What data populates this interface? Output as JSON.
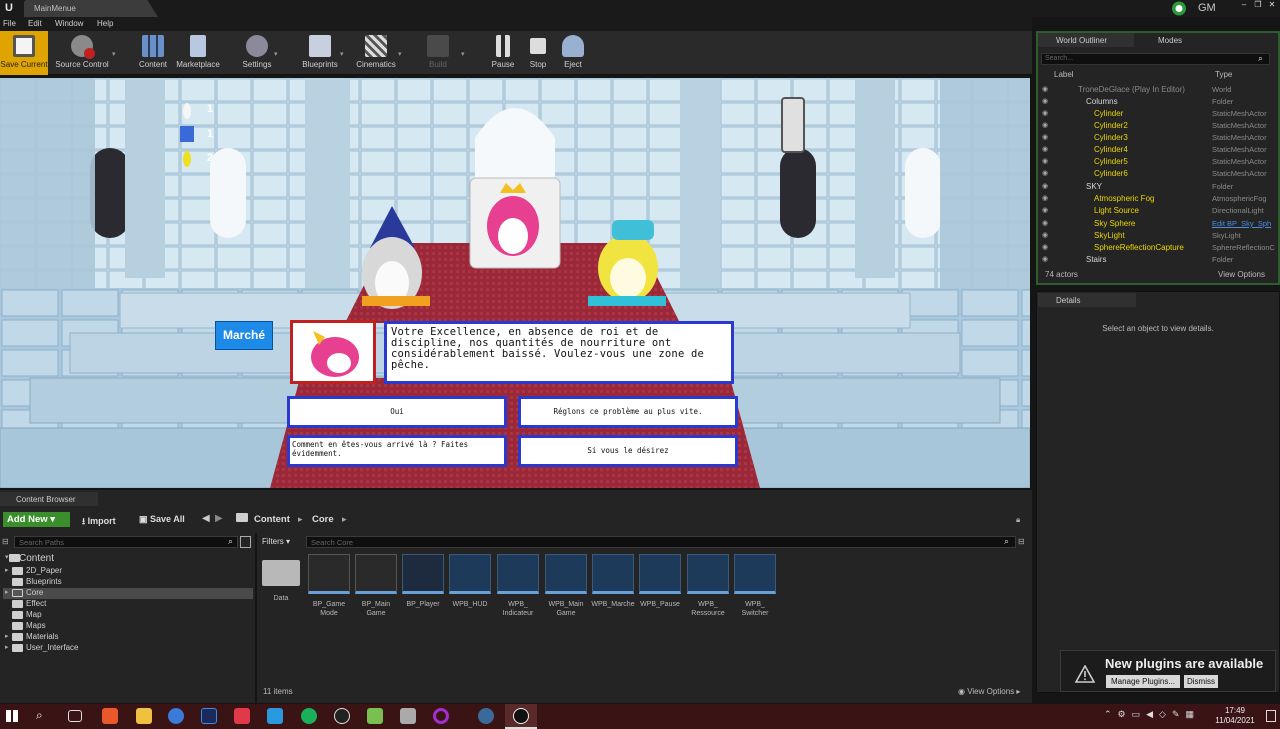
{
  "window": {
    "tab_title": "MainMenue",
    "user_badge": "GM",
    "menu": [
      "File",
      "Edit",
      "Window",
      "Help"
    ]
  },
  "toolbar": {
    "save_current": "Save Current",
    "source_control": "Source Control",
    "content": "Content",
    "marketplace": "Marketplace",
    "settings": "Settings",
    "blueprints": "Blueprints",
    "cinematics": "Cinematics",
    "build": "Build",
    "pause": "Pause",
    "stop": "Stop",
    "eject": "Eject"
  },
  "game": {
    "resources": [
      "1",
      "1",
      "2"
    ],
    "marche_button": "Marché",
    "dialog_text": "Votre Excellence, en absence de roi et de discipline, nos quantités de nourriture ont considérablement baissé. Voulez-vous une zone de pêche.",
    "choices": [
      "Oui",
      "Réglons ce problème au plus vite.",
      "Comment en êtes-vous arrivé là ? Faites évidemment.",
      "Si vous le désirez"
    ]
  },
  "outliner": {
    "tab": "World Outliner",
    "modes_tab": "Modes",
    "search_placeholder": "Search...",
    "col_label": "Label",
    "col_type": "Type",
    "rows": [
      {
        "label": "TroneDeGlace (Play In Editor)",
        "type": "World"
      },
      {
        "label": "Columns",
        "type": "Folder"
      },
      {
        "label": "Cylinder",
        "type": "StaticMeshActor"
      },
      {
        "label": "Cylinder2",
        "type": "StaticMeshActor"
      },
      {
        "label": "Cylinder3",
        "type": "StaticMeshActor"
      },
      {
        "label": "Cylinder4",
        "type": "StaticMeshActor"
      },
      {
        "label": "Cylinder5",
        "type": "StaticMeshActor"
      },
      {
        "label": "Cylinder6",
        "type": "StaticMeshActor"
      },
      {
        "label": "SKY",
        "type": "Folder"
      },
      {
        "label": "Atmospheric Fog",
        "type": "AtmosphericFog"
      },
      {
        "label": "Light Source",
        "type": "DirectionalLight"
      },
      {
        "label": "Sky Sphere",
        "type": "Edit BP_Sky_Sph"
      },
      {
        "label": "SkyLight",
        "type": "SkyLight"
      },
      {
        "label": "SphereReflectionCapture",
        "type": "SphereReflectionC"
      },
      {
        "label": "Stairs",
        "type": "Folder"
      }
    ],
    "actor_count": "74 actors",
    "view_options": "View Options"
  },
  "details": {
    "tab": "Details",
    "empty_msg": "Select an object to view details."
  },
  "notification": {
    "title": "New plugins are available",
    "manage": "Manage Plugins...",
    "dismiss": "Dismiss"
  },
  "content_browser": {
    "tab": "Content Browser",
    "add_new": "Add New",
    "import": "Import",
    "save_all": "Save All",
    "path": [
      "Content",
      "Core"
    ],
    "search_paths": "Search Paths",
    "filters": "Filters",
    "search_core": "Search Core",
    "tree": [
      {
        "label": "Content"
      },
      {
        "label": "2D_Paper"
      },
      {
        "label": "Blueprints"
      },
      {
        "label": "Core"
      },
      {
        "label": "Effect"
      },
      {
        "label": "Map"
      },
      {
        "label": "Maps"
      },
      {
        "label": "Materials"
      },
      {
        "label": "User_Interface"
      }
    ],
    "assets": [
      {
        "name": "Data",
        "kind": "folder"
      },
      {
        "name": "BP_Game Mode",
        "kind": "gamepad"
      },
      {
        "name": "BP_Main Game",
        "kind": "gamepad"
      },
      {
        "name": "BP_Player",
        "kind": "player"
      },
      {
        "name": "WPB_HUD",
        "kind": "widget"
      },
      {
        "name": "WPB_ Indicateur",
        "kind": "widget"
      },
      {
        "name": "WPB_Main Game",
        "kind": "widget"
      },
      {
        "name": "WPB_Marche",
        "kind": "widget"
      },
      {
        "name": "WPB_Pause",
        "kind": "widget"
      },
      {
        "name": "WPB_ Ressource",
        "kind": "widget"
      },
      {
        "name": "WPB_ Switcher",
        "kind": "widget"
      }
    ],
    "item_count": "11 items",
    "view_options": "View Options"
  },
  "taskbar": {
    "time": "17:49",
    "date": "11/04/2021"
  }
}
